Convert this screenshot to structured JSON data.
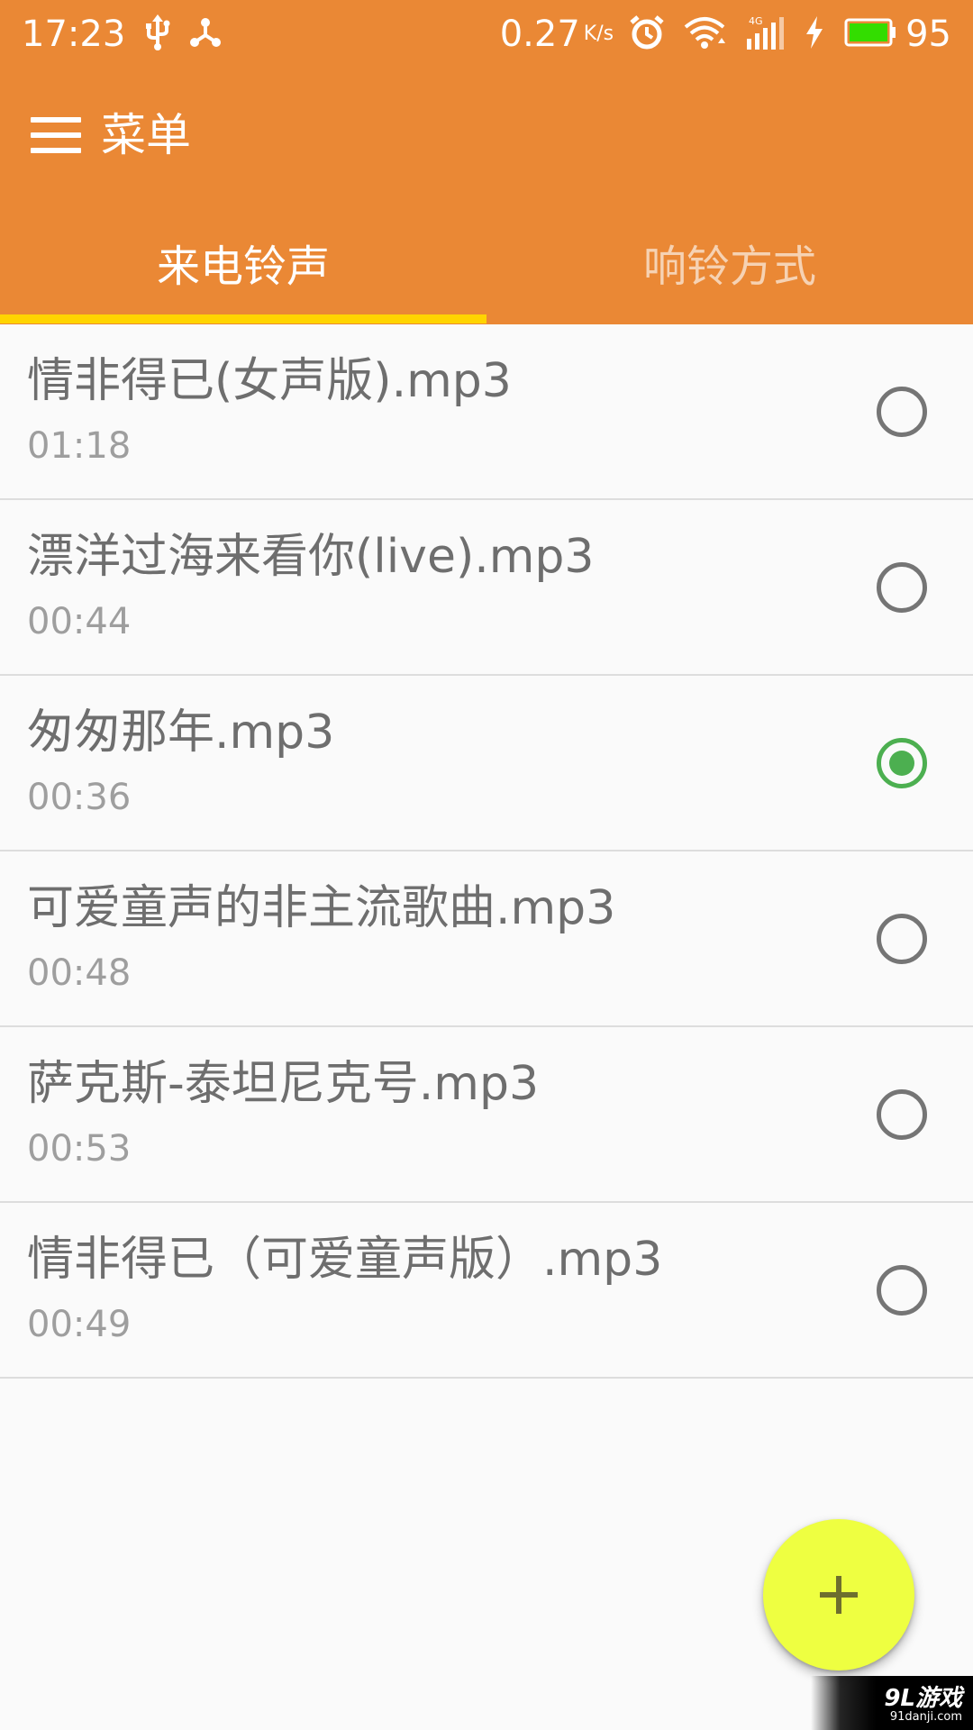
{
  "status_bar": {
    "time": "17:23",
    "net_speed": "0.27",
    "net_speed_unit": "K/s",
    "battery_level": "95",
    "icons": [
      "usb-icon",
      "share-icon",
      "alarm-icon",
      "wifi-icon",
      "signal-4g-icon",
      "charging-icon",
      "battery-icon"
    ]
  },
  "app_bar": {
    "menu_label": "菜单",
    "menu_icon": "hamburger-icon"
  },
  "tabs": [
    {
      "label": "来电铃声",
      "selected": true
    },
    {
      "label": "响铃方式",
      "selected": false
    }
  ],
  "ringtones": [
    {
      "name": "情非得已(女声版).mp3",
      "duration": "01:18",
      "selected": false
    },
    {
      "name": "漂洋过海来看你(live).mp3",
      "duration": "00:44",
      "selected": false
    },
    {
      "name": "匆匆那年.mp3",
      "duration": "00:36",
      "selected": true
    },
    {
      "name": "可爱童声的非主流歌曲.mp3",
      "duration": "00:48",
      "selected": false
    },
    {
      "name": "萨克斯-泰坦尼克号.mp3",
      "duration": "00:53",
      "selected": false
    },
    {
      "name": "情非得已（可爱童声版）.mp3",
      "duration": "00:49",
      "selected": false
    }
  ],
  "fab": {
    "icon": "plus-icon"
  },
  "watermark": {
    "logo": "9L游戏",
    "url": "91danji.com"
  },
  "colors": {
    "primary": "#EA8835",
    "tab_indicator": "#FFD400",
    "radio_checked": "#4CAF50",
    "fab": "#EEFF41",
    "battery_fill": "#33DD00"
  }
}
